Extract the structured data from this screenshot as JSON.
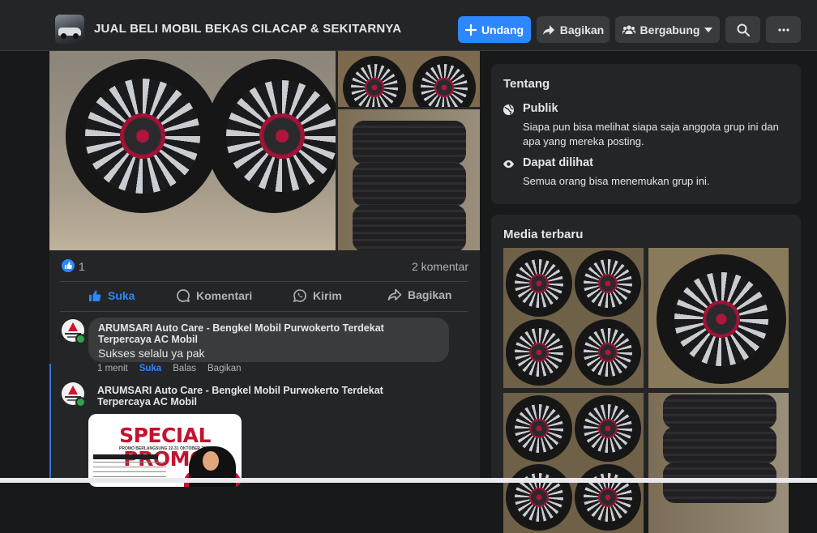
{
  "header": {
    "group_name": "JUAL BELI MOBIL BEKAS CILACAP & SEKITARNYA",
    "buttons": {
      "invite": "Undang",
      "share": "Bagikan",
      "joined": "Bergabung"
    }
  },
  "post": {
    "reaction_count": "1",
    "comment_count": "2 komentar",
    "actions": {
      "like": "Suka",
      "comment": "Komentari",
      "send": "Kirim",
      "share": "Bagikan"
    },
    "comments": [
      {
        "author": "ARUMSARI Auto Care - Bengkel Mobil Purwokerto Terdekat Terpercaya AC Mobil",
        "text": "Sukses selalu ya pak",
        "time": "1 menit",
        "like": "Suka",
        "reply": "Balas",
        "share": "Bagikan"
      },
      {
        "author": "ARUMSARI Auto Care - Bengkel Mobil Purwokerto Terdekat Terpercaya AC Mobil",
        "image_text": "SPECIAL PROMO",
        "image_subtext": "PROMO BERLANGSUNG 22-31 OKTOBER 2024"
      }
    ]
  },
  "about": {
    "heading": "Tentang",
    "privacy": {
      "title": "Publik",
      "desc": "Siapa pun bisa melihat siapa saja anggota grup ini dan apa yang mereka posting."
    },
    "visibility": {
      "title": "Dapat dilihat",
      "desc": "Semua orang bisa menemukan grup ini."
    }
  },
  "media": {
    "heading": "Media terbaru"
  },
  "colors": {
    "accent": "#2d88ff",
    "card": "#242526",
    "bg": "#18191a",
    "online": "#31a24c"
  }
}
